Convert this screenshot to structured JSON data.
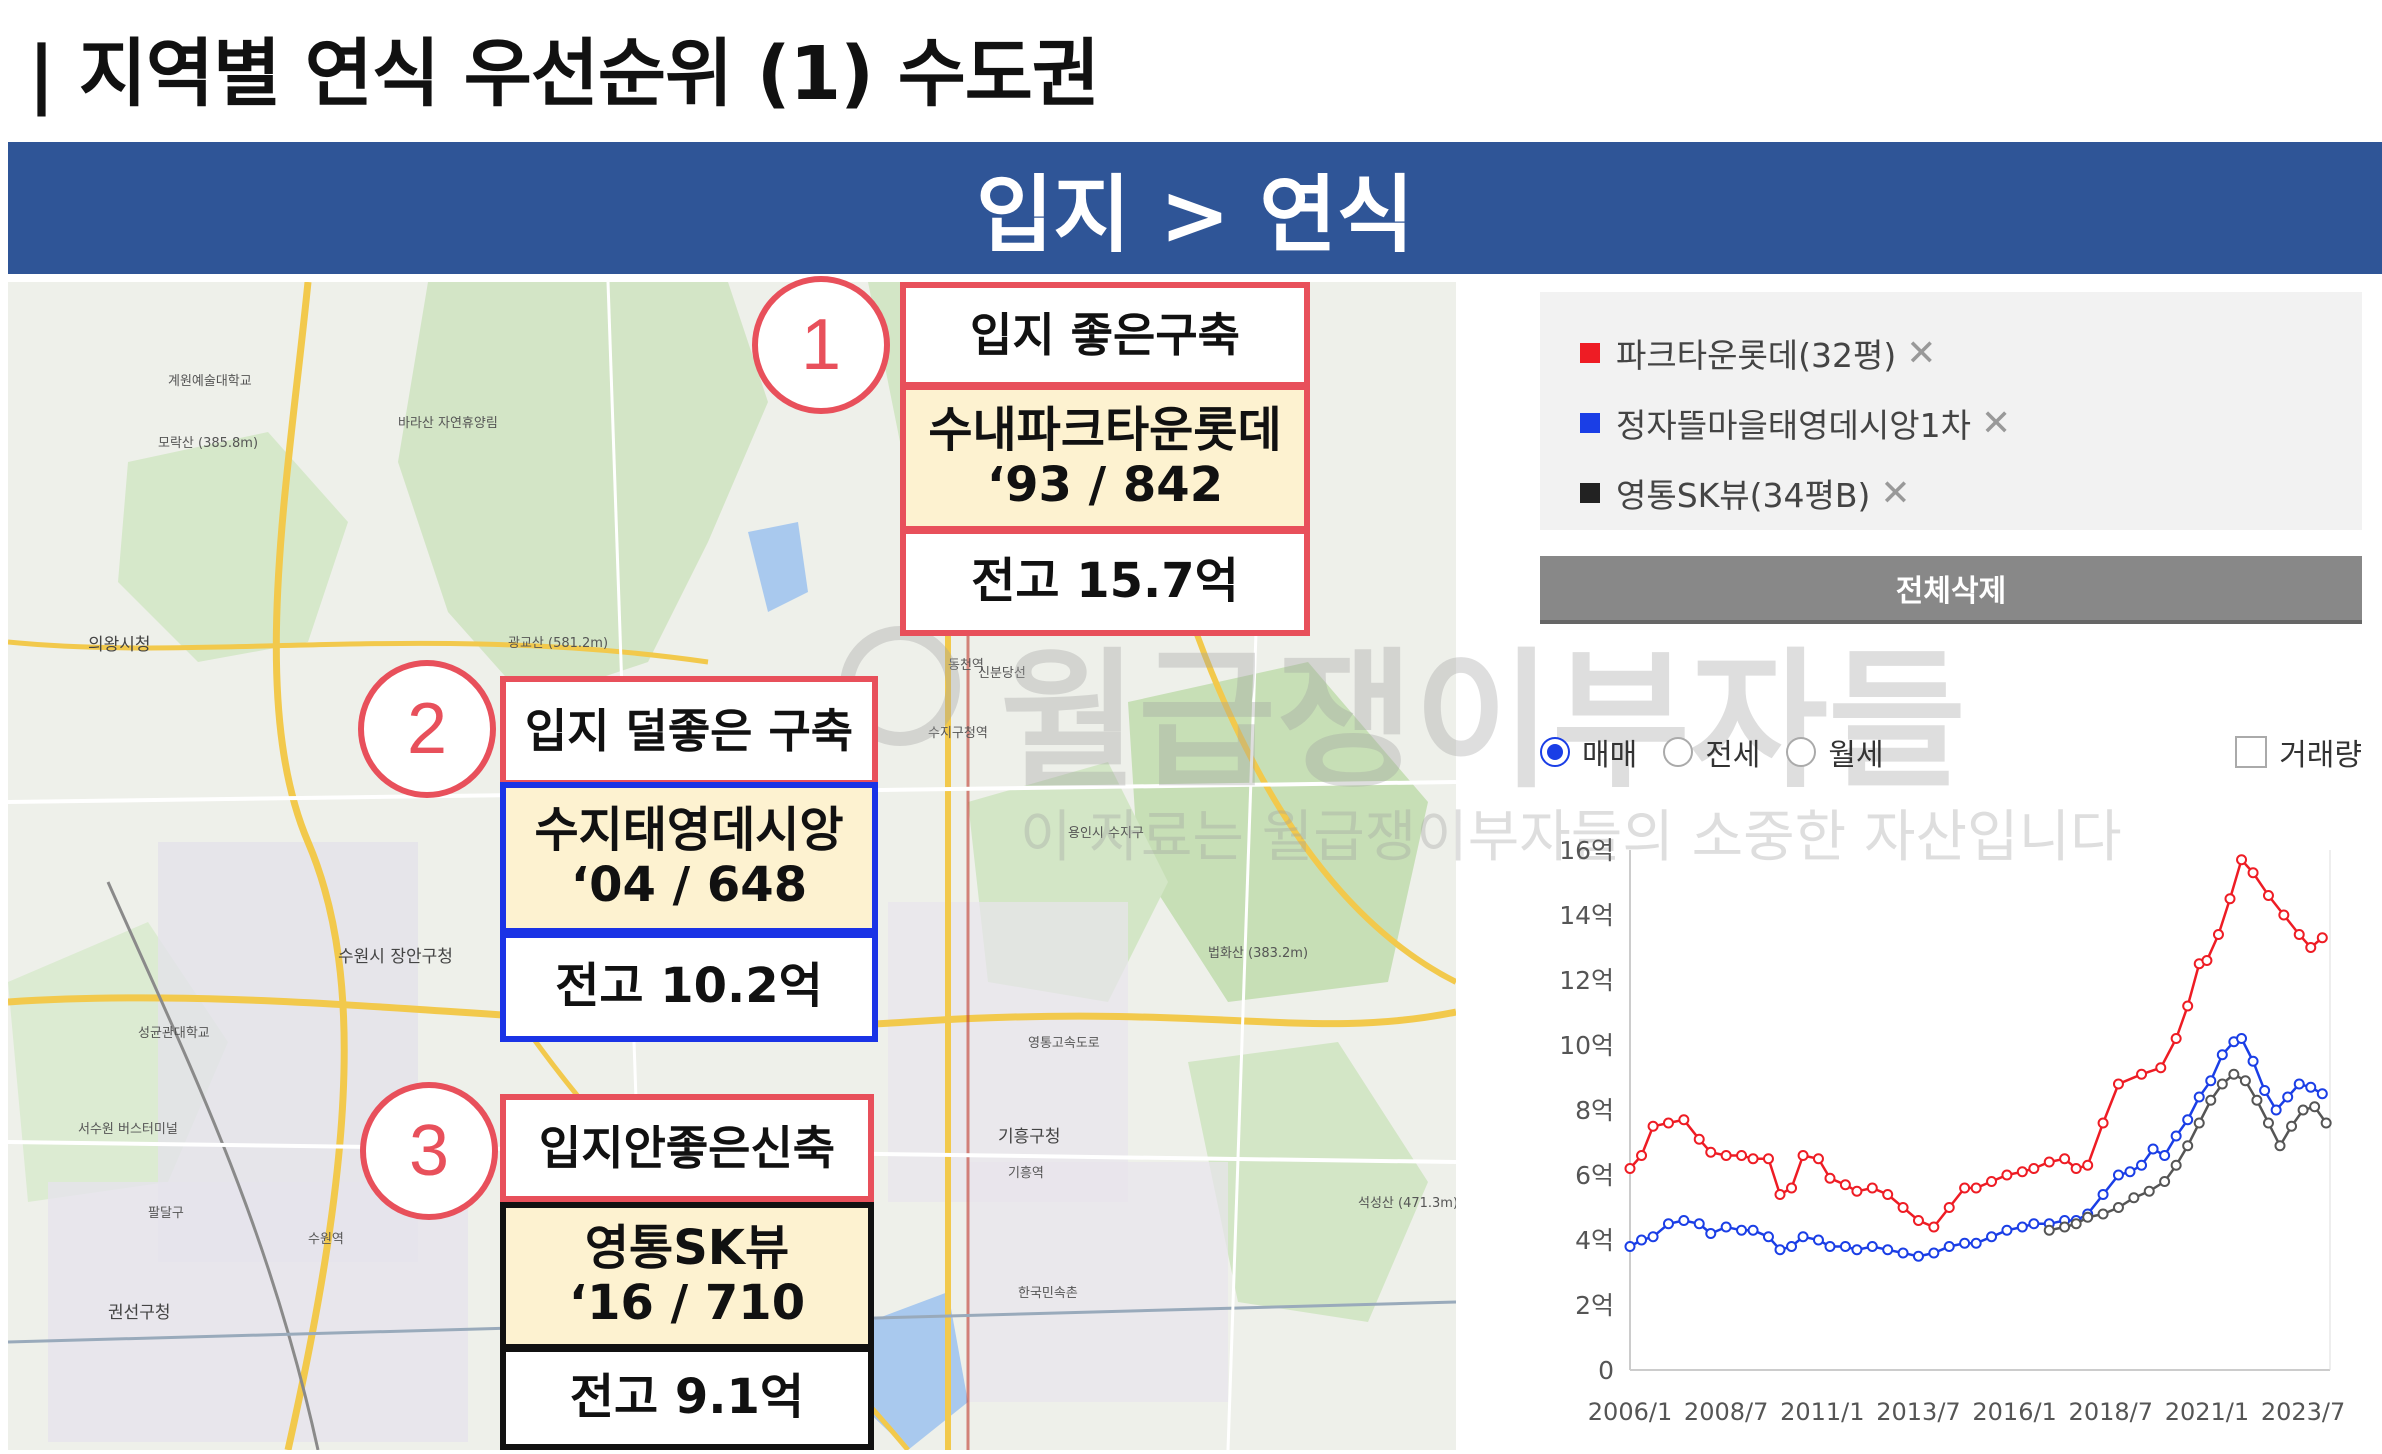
{
  "page_title": "| 지역별 연식 우선순위 (1) 수도권",
  "banner": "입지 > 연식",
  "map": {
    "labels": [
      "의왕시청",
      "계원예술대학교",
      "모락산 (385.8m)",
      "바라산 자연휴양림",
      "광교산 (581.2m)",
      "수원시 장안구청",
      "권선구청",
      "기흥구청",
      "신분당선",
      "영통고속도로",
      "용인시 수지구",
      "성균관대학교",
      "법화산 (383.2m)",
      "석성산 (471.3m)",
      "서수원 버스터미널",
      "수원역",
      "팔달구",
      "동천역",
      "수지구청역",
      "기흥역",
      "한국민속촌"
    ]
  },
  "callouts": [
    {
      "num": "1",
      "head": "입지 좋은구축",
      "name": "수내파크타운롯데",
      "meta": "‘93 / 842",
      "price": "전고 15.7억"
    },
    {
      "num": "2",
      "head": "입지 덜좋은 구축",
      "name": "수지태영데시앙",
      "meta": "‘04 / 648",
      "price": "전고 10.2억"
    },
    {
      "num": "3",
      "head": "입지안좋은신축",
      "name": "영통SK뷰",
      "meta": "‘16 / 710",
      "price": "전고 9.1억"
    }
  ],
  "watermark": {
    "main": "월급쟁이부자들",
    "sub": "이 자료는 월급쟁이부자들의 소중한 자산입니다"
  },
  "legend": [
    {
      "label": "파크타운롯데(32평)",
      "color": "#ee1c24"
    },
    {
      "label": "정자뜰마을태영데시앙1차",
      "color": "#1a3ee6"
    },
    {
      "label": "영통SK뷰(34평B)",
      "color": "#222222"
    }
  ],
  "legend_close": "✕",
  "delete_all": "전체삭제",
  "filters": {
    "sale": "매매",
    "jeonse": "전세",
    "monthly": "월세",
    "volume": "거래량",
    "selected": "매매"
  },
  "chart_data": {
    "type": "line",
    "ylim": [
      0,
      16
    ],
    "y_ticks": [
      "0",
      "2억",
      "4억",
      "6억",
      "8억",
      "10억",
      "12억",
      "14억",
      "16억"
    ],
    "x_ticks": [
      "2006/1",
      "2008/7",
      "2011/1",
      "2013/7",
      "2016/1",
      "2018/7",
      "2021/1",
      "2023/7"
    ],
    "x_range": [
      2006.0,
      2024.2
    ],
    "series": [
      {
        "name": "파크타운롯데(32평)",
        "color": "#ee1c24",
        "points": [
          [
            2006.0,
            6.2
          ],
          [
            2006.3,
            6.6
          ],
          [
            2006.6,
            7.5
          ],
          [
            2007.0,
            7.6
          ],
          [
            2007.4,
            7.7
          ],
          [
            2007.8,
            7.1
          ],
          [
            2008.1,
            6.7
          ],
          [
            2008.5,
            6.6
          ],
          [
            2008.9,
            6.6
          ],
          [
            2009.2,
            6.5
          ],
          [
            2009.6,
            6.5
          ],
          [
            2009.9,
            5.4
          ],
          [
            2010.2,
            5.6
          ],
          [
            2010.5,
            6.6
          ],
          [
            2010.9,
            6.5
          ],
          [
            2011.2,
            5.9
          ],
          [
            2011.6,
            5.7
          ],
          [
            2011.9,
            5.5
          ],
          [
            2012.3,
            5.6
          ],
          [
            2012.7,
            5.4
          ],
          [
            2013.1,
            5.0
          ],
          [
            2013.5,
            4.6
          ],
          [
            2013.9,
            4.4
          ],
          [
            2014.3,
            5.0
          ],
          [
            2014.7,
            5.6
          ],
          [
            2015.0,
            5.6
          ],
          [
            2015.4,
            5.8
          ],
          [
            2015.8,
            6.0
          ],
          [
            2016.2,
            6.1
          ],
          [
            2016.5,
            6.2
          ],
          [
            2016.9,
            6.4
          ],
          [
            2017.3,
            6.5
          ],
          [
            2017.6,
            6.2
          ],
          [
            2017.9,
            6.3
          ],
          [
            2018.3,
            7.6
          ],
          [
            2018.7,
            8.8
          ],
          [
            2019.3,
            9.1
          ],
          [
            2019.8,
            9.3
          ],
          [
            2020.2,
            10.2
          ],
          [
            2020.5,
            11.2
          ],
          [
            2020.8,
            12.5
          ],
          [
            2021.0,
            12.6
          ],
          [
            2021.3,
            13.4
          ],
          [
            2021.6,
            14.5
          ],
          [
            2021.9,
            15.7
          ],
          [
            2022.2,
            15.3
          ],
          [
            2022.6,
            14.6
          ],
          [
            2023.0,
            14.0
          ],
          [
            2023.4,
            13.4
          ],
          [
            2023.7,
            13.0
          ],
          [
            2024.0,
            13.3
          ]
        ]
      },
      {
        "name": "정자뜰마을태영데시앙1차",
        "color": "#1a3ee6",
        "points": [
          [
            2006.0,
            3.8
          ],
          [
            2006.3,
            4.0
          ],
          [
            2006.6,
            4.1
          ],
          [
            2007.0,
            4.5
          ],
          [
            2007.4,
            4.6
          ],
          [
            2007.8,
            4.5
          ],
          [
            2008.1,
            4.2
          ],
          [
            2008.5,
            4.4
          ],
          [
            2008.9,
            4.3
          ],
          [
            2009.2,
            4.3
          ],
          [
            2009.6,
            4.1
          ],
          [
            2009.9,
            3.7
          ],
          [
            2010.2,
            3.8
          ],
          [
            2010.5,
            4.1
          ],
          [
            2010.9,
            4.0
          ],
          [
            2011.2,
            3.8
          ],
          [
            2011.6,
            3.8
          ],
          [
            2011.9,
            3.7
          ],
          [
            2012.3,
            3.8
          ],
          [
            2012.7,
            3.7
          ],
          [
            2013.1,
            3.6
          ],
          [
            2013.5,
            3.5
          ],
          [
            2013.9,
            3.6
          ],
          [
            2014.3,
            3.8
          ],
          [
            2014.7,
            3.9
          ],
          [
            2015.0,
            3.9
          ],
          [
            2015.4,
            4.1
          ],
          [
            2015.8,
            4.3
          ],
          [
            2016.2,
            4.4
          ],
          [
            2016.5,
            4.5
          ],
          [
            2016.9,
            4.5
          ],
          [
            2017.3,
            4.6
          ],
          [
            2017.6,
            4.6
          ],
          [
            2017.9,
            4.8
          ],
          [
            2018.3,
            5.4
          ],
          [
            2018.7,
            6.0
          ],
          [
            2019.0,
            6.1
          ],
          [
            2019.3,
            6.3
          ],
          [
            2019.6,
            6.8
          ],
          [
            2019.9,
            6.6
          ],
          [
            2020.2,
            7.2
          ],
          [
            2020.5,
            7.7
          ],
          [
            2020.8,
            8.4
          ],
          [
            2021.1,
            8.9
          ],
          [
            2021.4,
            9.7
          ],
          [
            2021.7,
            10.1
          ],
          [
            2021.9,
            10.2
          ],
          [
            2022.2,
            9.5
          ],
          [
            2022.5,
            8.6
          ],
          [
            2022.8,
            8.0
          ],
          [
            2023.1,
            8.4
          ],
          [
            2023.4,
            8.8
          ],
          [
            2023.7,
            8.7
          ],
          [
            2024.0,
            8.5
          ]
        ]
      },
      {
        "name": "영통SK뷰(34평B)",
        "color": "#555555",
        "points": [
          [
            2016.9,
            4.3
          ],
          [
            2017.3,
            4.4
          ],
          [
            2017.6,
            4.5
          ],
          [
            2017.9,
            4.7
          ],
          [
            2018.3,
            4.8
          ],
          [
            2018.7,
            5.0
          ],
          [
            2019.1,
            5.3
          ],
          [
            2019.5,
            5.5
          ],
          [
            2019.9,
            5.8
          ],
          [
            2020.2,
            6.3
          ],
          [
            2020.5,
            6.9
          ],
          [
            2020.8,
            7.6
          ],
          [
            2021.1,
            8.3
          ],
          [
            2021.4,
            8.8
          ],
          [
            2021.7,
            9.1
          ],
          [
            2022.0,
            8.9
          ],
          [
            2022.3,
            8.3
          ],
          [
            2022.6,
            7.6
          ],
          [
            2022.9,
            6.9
          ],
          [
            2023.2,
            7.5
          ],
          [
            2023.5,
            8.0
          ],
          [
            2023.8,
            8.1
          ],
          [
            2024.1,
            7.6
          ]
        ]
      }
    ]
  }
}
